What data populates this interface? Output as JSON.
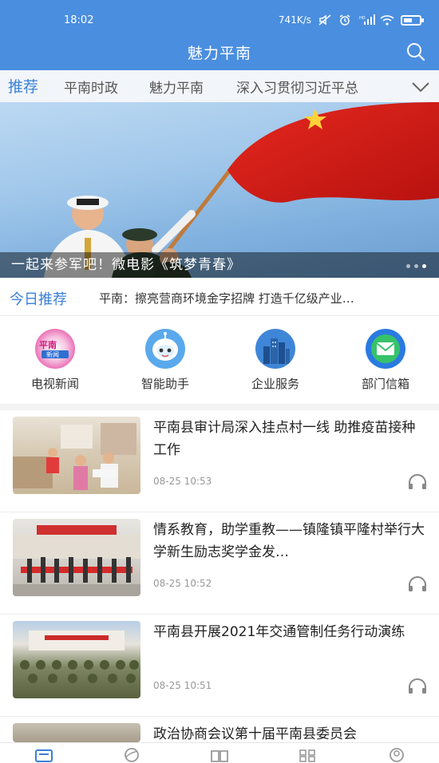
{
  "status": {
    "time": "18:02",
    "speed": "741K/s",
    "icons": [
      "mute-icon",
      "alarm-icon",
      "hd-signal-icon",
      "wifi-icon",
      "battery-icon"
    ]
  },
  "header": {
    "title": "魅力平南",
    "search_icon": "search-icon"
  },
  "tabs": {
    "items": [
      "推荐",
      "平南时政",
      "魅力平南",
      "深入习贯彻习近平总"
    ],
    "active": "推荐",
    "more_icon": "chevron-down-icon"
  },
  "banner": {
    "caption": "一起来参军吧！微电影《筑梦青春》",
    "dots": 3,
    "active_dot": 3
  },
  "today": {
    "label": "今日推荐",
    "text": "平南：擦亮营商环境金字招牌 打造千亿级产业…"
  },
  "services": [
    {
      "label": "电视新闻",
      "icon": "tv-news-icon"
    },
    {
      "label": "智能助手",
      "icon": "robot-icon"
    },
    {
      "label": "企业服务",
      "icon": "buildings-icon"
    },
    {
      "label": "部门信箱",
      "icon": "mail-icon"
    }
  ],
  "news": [
    {
      "title": "平南县审计局深入挂点村一线 助推疫苗接种工作",
      "time": "08-25 10:53"
    },
    {
      "title": "情系教育，助学重教——镇隆镇平隆村举行大学新生励志奖学金发…",
      "time": "08-25 10:52"
    },
    {
      "title": "平南县开展2021年交通管制任务行动演练",
      "time": "08-25 10:51"
    },
    {
      "title": "政治协商会议第十届平南县委员会",
      "time": ""
    }
  ],
  "bottom_nav": [
    "home-icon",
    "discover-icon",
    "read-icon",
    "apps-icon",
    "user-icon"
  ],
  "colors": {
    "primary": "#4a8ee0",
    "accent": "#3a80d8",
    "flag": "#d9211e"
  }
}
